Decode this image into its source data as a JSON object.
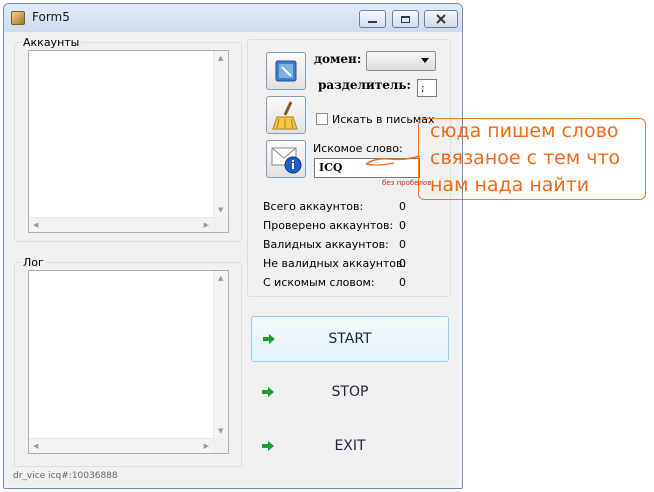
{
  "window": {
    "title": "Form5"
  },
  "accounts_group": {
    "label": "Аккаунты"
  },
  "log_group": {
    "label": "Лог"
  },
  "settings": {
    "domain_label": "домен:",
    "domain_value": "",
    "separator_label": "разделитель:",
    "separator_value": ";",
    "search_in_letters_label": "Искать в письмах",
    "search_in_letters_checked": false,
    "search_word_label": "Искомое слово:",
    "search_word_value": "ICQ"
  },
  "stats": [
    {
      "label": "Всего аккаунтов:",
      "value": "0"
    },
    {
      "label": "Проверено аккаунтов:",
      "value": "0"
    },
    {
      "label": "Валидных аккаунтов:",
      "value": "0"
    },
    {
      "label": "Не валидных аккаунтов:",
      "value": "0"
    },
    {
      "label": "С искомым словом:",
      "value": "0"
    }
  ],
  "buttons": {
    "start": "START",
    "stop": "STOP",
    "exit": "EXIT"
  },
  "status_text": "dr_vice icq#:10036888",
  "annotation": {
    "lines": [
      "сюда пишем слово",
      "связаное с тем что",
      "нам нада найти"
    ],
    "small_note": "без пробелов"
  },
  "colors": {
    "annotation": "#f06a1a",
    "go_arrow": "#1e9e2e",
    "focus_border": "#8fd1ee"
  }
}
